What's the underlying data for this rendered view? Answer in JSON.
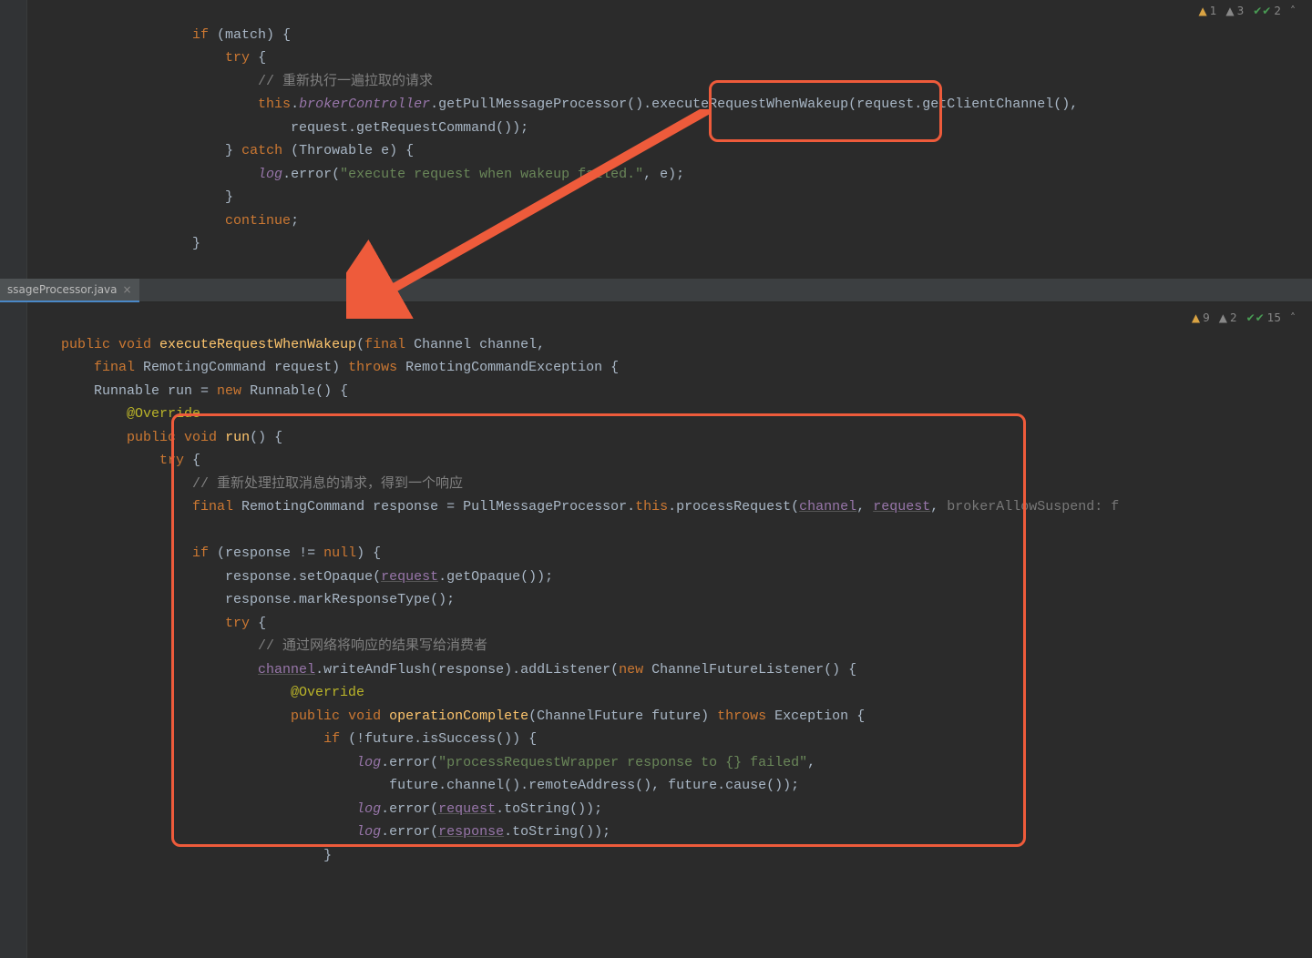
{
  "tabs": {
    "file1": "ssageProcessor.java"
  },
  "inspections_top": {
    "warn_yellow": "1",
    "warn_gray": "3",
    "pass": "2"
  },
  "inspections_bottom": {
    "warn_yellow": "9",
    "warn_gray": "2",
    "pass": "15"
  },
  "code_top": {
    "l1_kw_if": "if",
    "l1_cond": " (match) {",
    "l2_kw_try": "try",
    "l2_brace": " {",
    "l3_comment": "// 重新执行一遍拉取的请求",
    "l4_this": "this",
    "l4_dot1": ".",
    "l4_broker": "brokerController",
    "l4_call": ".getPullMessageProcessor().executeRequestWhenWakeup(request.getClientChannel(),",
    "l5": "request.getRequestCommand());",
    "l6_brace": "} ",
    "l6_catch": "catch",
    "l6_rest": " (Throwable e) {",
    "l7_log": "log",
    "l7_err": ".error(",
    "l7_str": "\"execute request when wakeup failed.\"",
    "l7_end": ", e);",
    "l8": "}",
    "l9_kw": "continue",
    "l9_semi": ";",
    "l10": "}"
  },
  "code_bottom": {
    "l1_public": "public",
    "l1_void": " void ",
    "l1_method": "executeRequestWhenWakeup",
    "l1_paren": "(",
    "l1_final1": "final",
    "l1_p1": " Channel channel,",
    "l2_final": "final",
    "l2_p2": " RemotingCommand request) ",
    "l2_throws": "throws",
    "l2_exc": " RemotingCommandException {",
    "l3_type": "Runnable run = ",
    "l3_new": "new",
    "l3_run": " Runnable() {",
    "l4_anno": "@Override",
    "l5_public": "public",
    "l5_void": " void ",
    "l5_method": "run",
    "l5_rest": "() {",
    "l6_try": "try",
    "l6_brace": " {",
    "l7_comment": "// 重新处理拉取消息的请求，得到一个响应",
    "l8_final": "final",
    "l8_rc": " RemotingCommand response = PullMessageProcessor.",
    "l8_this": "this",
    "l8_pr": ".processRequest(",
    "l8_ch": "channel",
    "l8_c1": ", ",
    "l8_req": "request",
    "l8_c2": ", ",
    "l8_hint": "brokerAllowSuspend: f",
    "l10_if": "if",
    "l10_cond": " (response != ",
    "l10_null": "null",
    "l10_end": ") {",
    "l11_a": "response.setOpaque(",
    "l11_req": "request",
    "l11_b": ".getOpaque());",
    "l12": "response.markResponseType();",
    "l13_try": "try",
    "l13_brace": " {",
    "l14_comment": "// 通过网络将响应的结果写给消费者",
    "l15_ch": "channel",
    "l15_mid": ".writeAndFlush(response).addListener(",
    "l15_new": "new",
    "l15_cfl": " ChannelFutureListener() {",
    "l16_anno": "@Override",
    "l17_public": "public",
    "l17_void": " void ",
    "l17_method": "operationComplete",
    "l17_args": "(ChannelFuture future) ",
    "l17_throws": "throws",
    "l17_exc": " Exception {",
    "l18_if": "if",
    "l18_cond": " (!future.isSuccess()) {",
    "l19_log": "log",
    "l19_err": ".error(",
    "l19_str": "\"processRequestWrapper response to {} failed\"",
    "l19_end": ",",
    "l20": "future.channel().remoteAddress(), future.cause());",
    "l21_log": "log",
    "l21_err": ".error(",
    "l21_req": "request",
    "l21_end": ".toString());",
    "l22_log": "log",
    "l22_err": ".error(",
    "l22_res": "response",
    "l22_end": ".toString());",
    "l23": "}"
  }
}
